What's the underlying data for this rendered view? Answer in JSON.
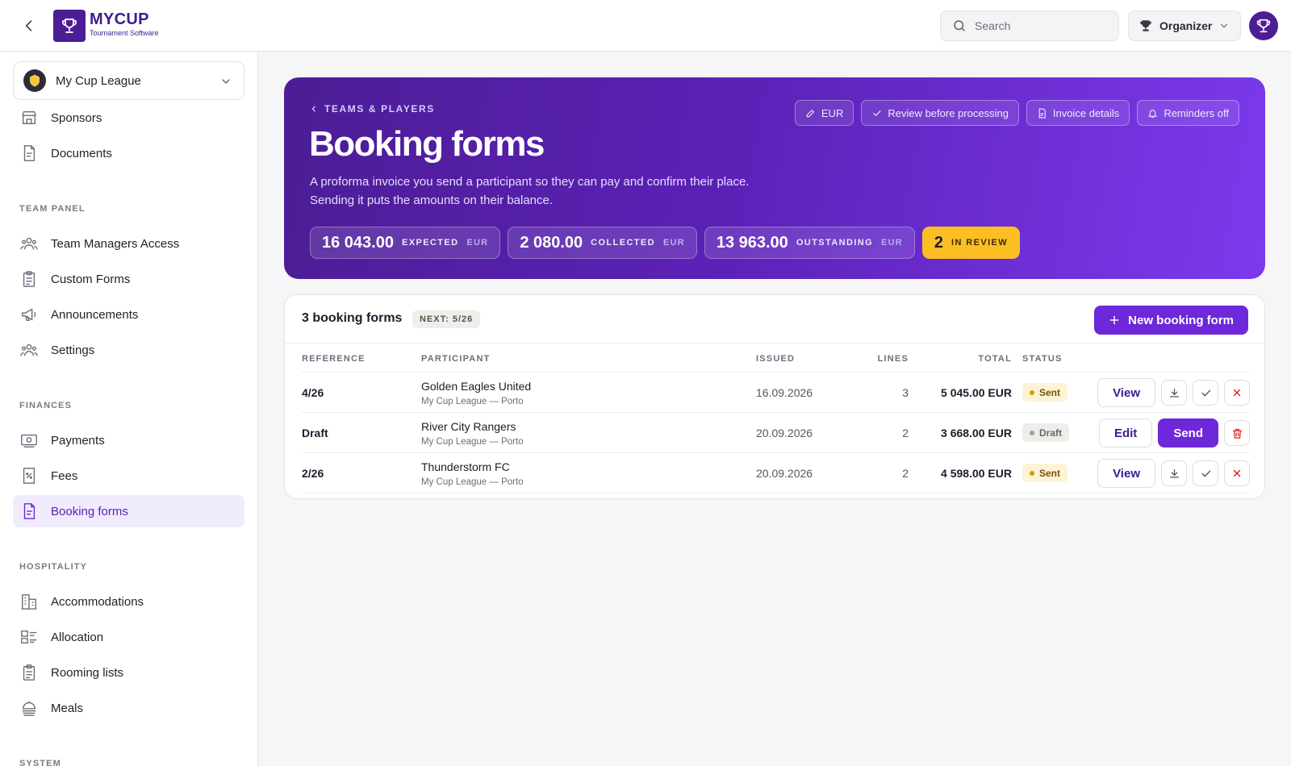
{
  "header": {
    "brand_name": "MYCUP",
    "brand_sub": "Tournament Software",
    "search_placeholder": "Search",
    "role": "Organizer"
  },
  "sidebar": {
    "org_name": "My Cup League",
    "items_top": [
      {
        "label": "Sponsors",
        "icon": "building-icon"
      },
      {
        "label": "Documents",
        "icon": "document-icon"
      }
    ],
    "sections": [
      {
        "title": "TEAM PANEL",
        "items": [
          {
            "label": "Team Managers Access",
            "icon": "users-icon"
          },
          {
            "label": "Custom Forms",
            "icon": "clipboard-icon"
          },
          {
            "label": "Announcements",
            "icon": "megaphone-icon"
          },
          {
            "label": "Settings",
            "icon": "group-settings-icon"
          }
        ]
      },
      {
        "title": "FINANCES",
        "items": [
          {
            "label": "Payments",
            "icon": "cash-icon"
          },
          {
            "label": "Fees",
            "icon": "receipt-icon"
          },
          {
            "label": "Booking forms",
            "icon": "document-icon",
            "active": true
          }
        ]
      },
      {
        "title": "HOSPITALITY",
        "items": [
          {
            "label": "Accommodations",
            "icon": "hotel-icon"
          },
          {
            "label": "Allocation",
            "icon": "allocation-icon"
          },
          {
            "label": "Rooming lists",
            "icon": "clipboard-icon"
          },
          {
            "label": "Meals",
            "icon": "meal-icon"
          }
        ]
      },
      {
        "title": "SYSTEM",
        "items": []
      }
    ]
  },
  "hero": {
    "breadcrumb": "TEAMS & PLAYERS",
    "title": "Booking forms",
    "description_line1": "A proforma invoice you send a participant so they can pay and confirm their place.",
    "description_line2": "Sending it puts the amounts on their balance.",
    "chips": [
      {
        "label": "EUR",
        "icon": "pencil-icon"
      },
      {
        "label": "Review before processing",
        "icon": "check-icon"
      },
      {
        "label": "Invoice details",
        "icon": "file-icon"
      },
      {
        "label": "Reminders off",
        "icon": "bell-icon"
      }
    ],
    "stats": [
      {
        "value": "16 043.00",
        "label": "EXPECTED",
        "currency": "EUR"
      },
      {
        "value": "2 080.00",
        "label": "COLLECTED",
        "currency": "EUR"
      },
      {
        "value": "13 963.00",
        "label": "OUTSTANDING",
        "currency": "EUR"
      }
    ],
    "review": {
      "value": "2",
      "label": "IN REVIEW"
    }
  },
  "table": {
    "title": "3 booking forms",
    "next_badge": "NEXT: 5/26",
    "new_button": "New booking form",
    "columns": {
      "reference": "REFERENCE",
      "participant": "PARTICIPANT",
      "issued": "ISSUED",
      "lines": "LINES",
      "total": "TOTAL",
      "status": "STATUS"
    },
    "rows": [
      {
        "reference": "4/26",
        "participant": "Golden Eagles United",
        "location": "My Cup League — Porto",
        "issued": "16.09.2026",
        "lines": "3",
        "total": "5 045.00 EUR",
        "status": "Sent",
        "primary_action": "View"
      },
      {
        "reference": "Draft",
        "participant": "River City Rangers",
        "location": "My Cup League — Porto",
        "issued": "20.09.2026",
        "lines": "2",
        "total": "3 668.00 EUR",
        "status": "Draft",
        "primary_action": "Edit",
        "secondary_action": "Send"
      },
      {
        "reference": "2/26",
        "participant": "Thunderstorm FC",
        "location": "My Cup League — Porto",
        "issued": "20.09.2026",
        "lines": "2",
        "total": "4 598.00 EUR",
        "status": "Sent",
        "primary_action": "View"
      }
    ]
  },
  "colors": {
    "accent": "#6d28d9",
    "hero_start": "#4c1d95",
    "hero_end": "#7c3aed",
    "review": "#fbbf24",
    "danger": "#dc2626"
  }
}
